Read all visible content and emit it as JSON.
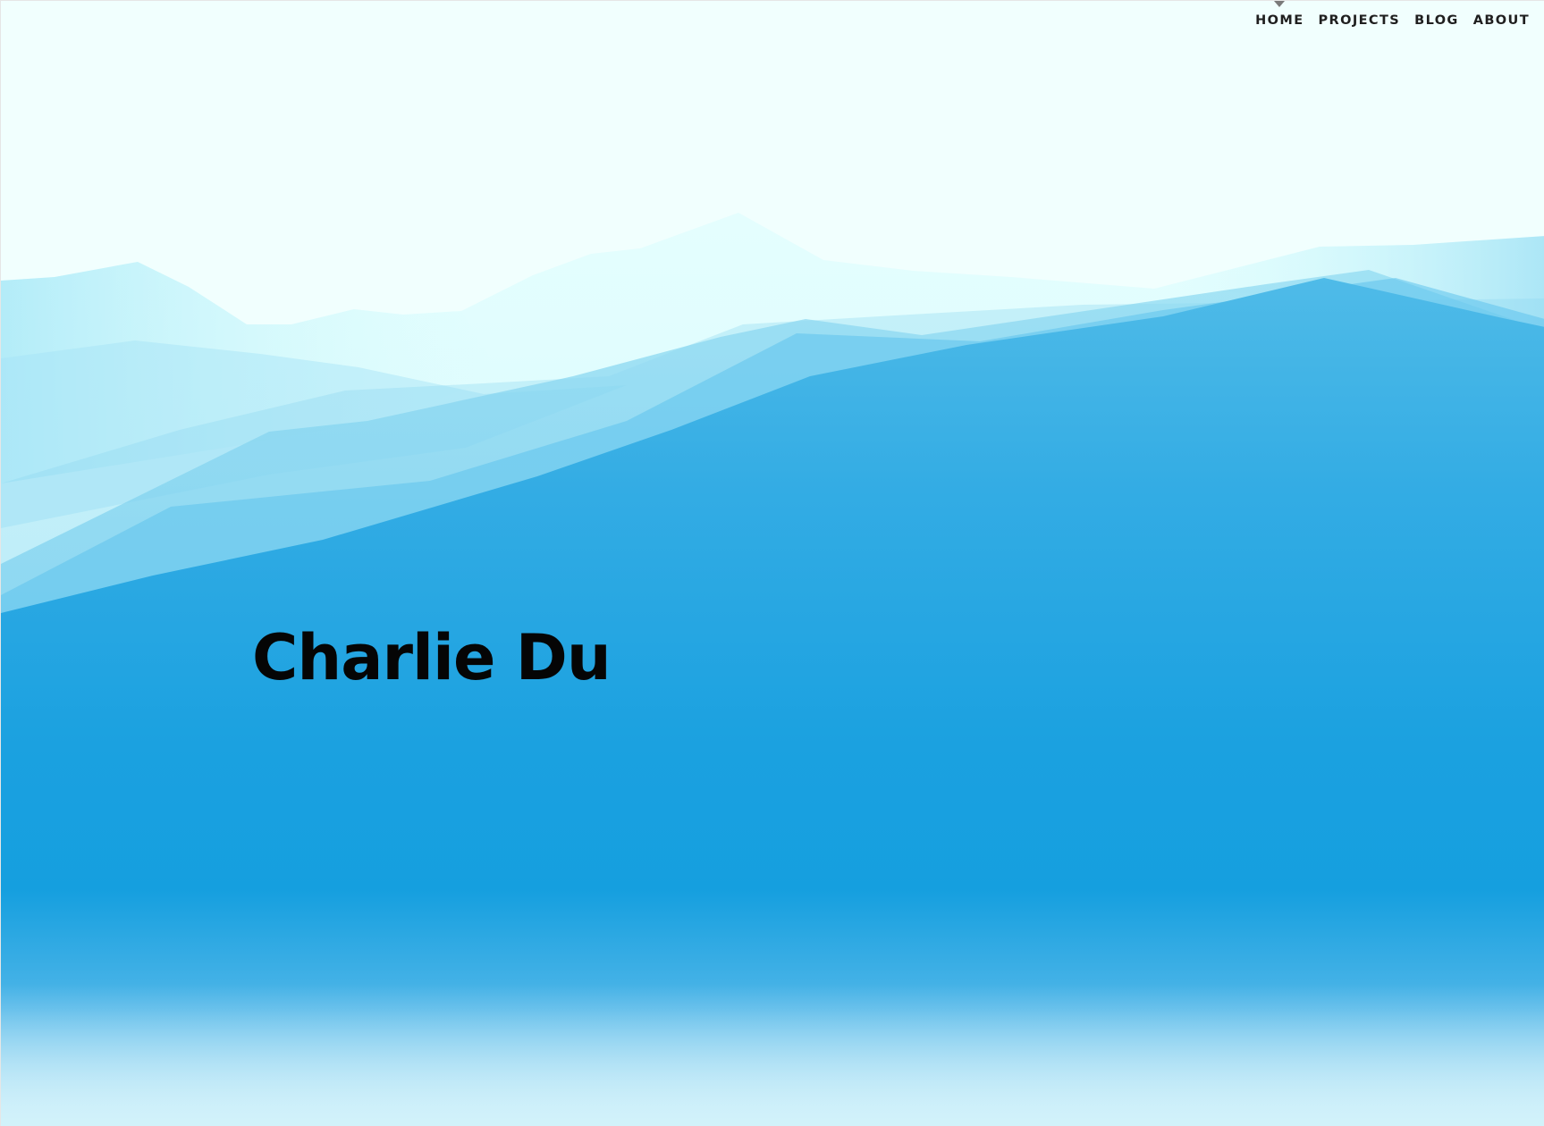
{
  "nav": {
    "items": [
      {
        "label": "HOME",
        "active": true
      },
      {
        "label": "PROJECTS",
        "active": false
      },
      {
        "label": "BLOG",
        "active": false
      },
      {
        "label": "ABOUT",
        "active": false
      }
    ]
  },
  "hero": {
    "name": "Charlie Du"
  },
  "colors": {
    "sky": "#f1fffe",
    "mountain_light": "#d9fcfd",
    "mountain_mid": "#7fd3f0",
    "mountain_deep": "#139fdf",
    "text": "#050505"
  }
}
